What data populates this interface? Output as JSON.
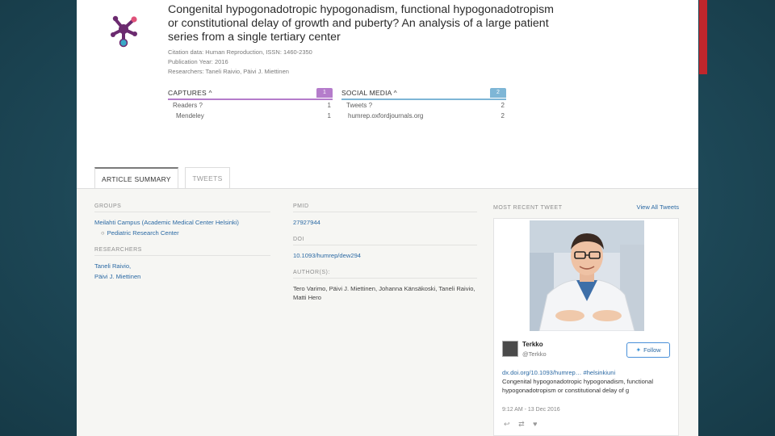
{
  "colors": {
    "captures_accent": "#b57ccb",
    "social_accent": "#7eb6d6",
    "link": "#2c6aa4"
  },
  "article": {
    "title": "Congenital hypogonadotropic hypogonadism, functional hypogonadotropism or constitutional delay of growth and puberty? An analysis of a large patient series from a single tertiary center",
    "citation": "Citation data: Human Reproduction, ISSN: 1460-2350",
    "pub_year": "Publication Year: 2016",
    "researchers": "Researchers: Taneli Raivio, Päivi J. Miettinen"
  },
  "metrics": {
    "captures": {
      "label": "CAPTURES ^",
      "count": "1",
      "rows": [
        {
          "label": "Readers ?",
          "value": "1"
        },
        {
          "label": "Mendeley",
          "value": "1"
        }
      ]
    },
    "social": {
      "label": "SOCIAL MEDIA ^",
      "count": "2",
      "rows": [
        {
          "label": "Tweets ?",
          "value": "2"
        },
        {
          "label": "humrep.oxfordjournals.org",
          "value": "2"
        }
      ]
    }
  },
  "tabs": [
    {
      "label": "ARTICLE SUMMARY"
    },
    {
      "label": "TWEETS"
    }
  ],
  "summary": {
    "groups_label": "GROUPS",
    "group_main": "Meilahti Campus (Academic Medical Center Helsinki)",
    "group_sub": "Pediatric Research Center",
    "researchers_label": "RESEARCHERS",
    "researcher1": "Taneli Raivio,",
    "researcher2": "Päivi J. Miettinen",
    "pmid_label": "PMID",
    "pmid": "27927944",
    "doi_label": "DOI",
    "doi": "10.1093/humrep/dew294",
    "authors_label": "AUTHOR(S):",
    "authors": "Tero Varimo, Päivi J. Miettinen, Johanna Känsäkoski, Taneli Raivio, Matti Hero"
  },
  "recent_tweet": {
    "label": "MOST RECENT TWEET",
    "view_all": "View All Tweets",
    "user_name": "Terkko",
    "user_handle": "@Terkko",
    "follow_label": "Follow",
    "link_line": "dx.doi.org/10.1093/humrep… #helsinkiuni",
    "text": "Congenital hypogonadotropic hypogonadism, functional hypogonadotropism or constitutional delay of g",
    "time": "9:12 AM - 13 Dec 2016"
  }
}
